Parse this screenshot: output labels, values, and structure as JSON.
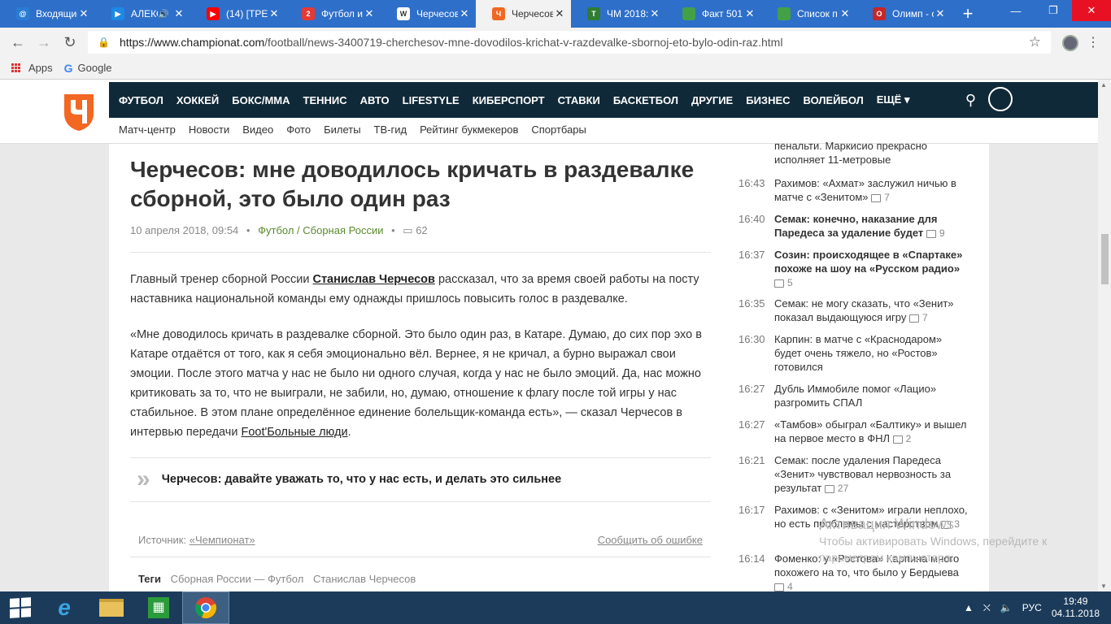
{
  "browser": {
    "tabs": [
      {
        "label": "Входящие",
        "color": "#2b7cd3",
        "glyph": "@"
      },
      {
        "label": "АЛЕКС",
        "color": "#1e88e5",
        "glyph": "▶",
        "sound": true
      },
      {
        "label": "(14) [ТРЕН",
        "color": "#ff0000",
        "glyph": "▶"
      },
      {
        "label": "Футбол и",
        "color": "#e53935",
        "glyph": "2"
      },
      {
        "label": "Черчесов",
        "color": "#ffffff",
        "glyph": "W"
      },
      {
        "label": "Черчесов",
        "color": "#f26722",
        "glyph": "Ч",
        "active": true
      },
      {
        "label": "ЧМ 2018:",
        "color": "#2e7d32",
        "glyph": "T"
      },
      {
        "label": "Факт 501",
        "color": "#43a047",
        "glyph": ""
      },
      {
        "label": "Список п",
        "color": "#43a047",
        "glyph": ""
      },
      {
        "label": "Олимп - с",
        "color": "#c62828",
        "glyph": "O"
      }
    ],
    "url_host": "https://www.championat.com",
    "url_path": "/football/news-3400719-cherchesov-mne-dovodilos-krichat-v-razdevalke-sbornoj-eto-bylo-odin-raz.html",
    "bookmarks": {
      "apps": "Apps",
      "google": "Google"
    }
  },
  "site": {
    "nav": [
      "ФУТБОЛ",
      "ХОККЕЙ",
      "БОКС/ММА",
      "ТЕННИС",
      "АВТО",
      "LIFESTYLE",
      "КИБЕРСПОРТ",
      "СТАВКИ",
      "БАСКЕТБОЛ",
      "ДРУГИЕ",
      "БИЗНЕС",
      "ВОЛЕЙБОЛ",
      "ЕЩЁ ▾"
    ],
    "subnav": [
      "Матч-центр",
      "Новости",
      "Видео",
      "Фото",
      "Билеты",
      "ТВ-гид",
      "Рейтинг букмекеров",
      "Спортбары"
    ]
  },
  "article": {
    "title": "Черчесов: мне доводилось кричать в раздевалке сборной, это было один раз",
    "date": "10 апреля 2018, 09:54",
    "category": "Футбол / Сборная России",
    "comments": "62",
    "p1_before": "Главный тренер сборной России ",
    "p1_link": "Станислав Черчесов",
    "p1_after": " рассказал, что за время своей работы на посту наставника национальной команды ему однажды пришлось повысить голос в раздевалке.",
    "p2_before": "«Мне доводилось кричать в раздевалке сборной. Это было один раз, в Катаре. Думаю, до сих пор эхо в Катаре отдаётся от того, как я себя эмоционально вёл. Вернее, я не кричал, а бурно выражал свои эмоции. После этого матча у нас не было ни одного случая, когда у нас не было эмоций. Да, нас можно критиковать за то, что не выиграли, не забили, но, думаю, отношение к флагу после той игры у нас стабильное. В этом плане определённое единение болельщик-команда есть», — сказал Черчесов в интервью передачи ",
    "p2_link": "Foot'Больные люди",
    "p2_after": ".",
    "related": "Черчесов: давайте уважать то, что у нас есть, и делать это сильнее",
    "source_label": "Источник: ",
    "source": "«Чемпионат»",
    "report_error": "Сообщить об ошибке",
    "tags_label": "Теги",
    "tags": [
      "Сборная России — Футбол",
      "Станислав Черчесов"
    ]
  },
  "sidebar": [
    {
      "time": "",
      "text": "пенальти. Маркисио прекрасно исполняет 11-метровые",
      "comments": "",
      "bold": false
    },
    {
      "time": "16:43",
      "text": "Рахимов: «Ахмат» заслужил ничью в матче с «Зенитом»",
      "comments": "7",
      "bold": false
    },
    {
      "time": "16:40",
      "text": "Семак: конечно, наказание для Паредеса за удаление будет",
      "comments": "9",
      "bold": true
    },
    {
      "time": "16:37",
      "text": "Созин: происходящее в «Спартаке» похоже на шоу на «Русском радио»",
      "comments": "5",
      "bold": true
    },
    {
      "time": "16:35",
      "text": "Семак: не могу сказать, что «Зенит» показал выдающуюся игру",
      "comments": "7",
      "bold": false
    },
    {
      "time": "16:30",
      "text": "Карпин: в матче с «Краснодаром» будет очень тяжело, но «Ростов» готовился",
      "comments": "",
      "bold": false
    },
    {
      "time": "16:27",
      "text": "Дубль Иммобиле помог «Лацио» разгромить СПАЛ",
      "comments": "",
      "bold": false
    },
    {
      "time": "16:27",
      "text": "«Тамбов» обыграл «Балтику» и вышел на первое место в ФНЛ",
      "comments": "2",
      "bold": false
    },
    {
      "time": "16:21",
      "text": "Семак: после удаления Паредеса «Зенит» чувствовал нервозность за результат",
      "comments": "27",
      "bold": false
    },
    {
      "time": "16:17",
      "text": "Рахимов: с «Зенитом» играли неплохо, но есть проблемы с мастерством",
      "comments": "3",
      "bold": false
    },
    {
      "time": "16:14",
      "text": "Фоменко: у «Ростова» Карпина много похожего на то, что было у Бердыева",
      "comments": "4",
      "bold": false
    }
  ],
  "watermark": {
    "title": "Активация Windows",
    "sub": "Чтобы активировать Windows, перейдите к параметрам компьютера."
  },
  "taskbar": {
    "lang": "РУС",
    "time": "19:49",
    "date": "04.11.2018"
  }
}
